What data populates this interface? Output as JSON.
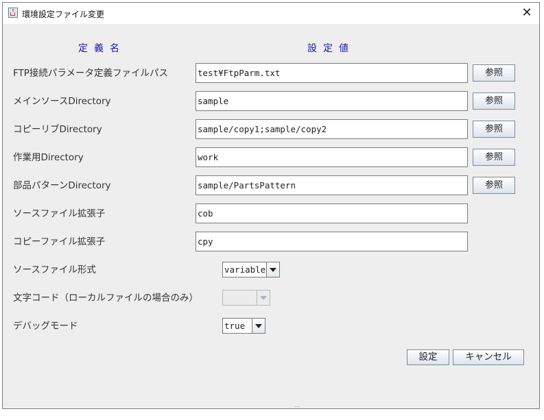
{
  "window": {
    "title": "環境設定ファイル変更",
    "close_glyph": "✕",
    "app_icon": "java-app-icon"
  },
  "headers": {
    "name_column": "定義名",
    "value_column": "設定値"
  },
  "fields": [
    {
      "label": "FTP接続パラメータ定義ファイルパス",
      "value": "test¥FtpParm.txt",
      "browse_label": "参照"
    },
    {
      "label": "メインソースDirectory",
      "value": "sample",
      "browse_label": "参照"
    },
    {
      "label": "コピーリブDirectory",
      "value": "sample/copy1;sample/copy2",
      "browse_label": "参照"
    },
    {
      "label": "作業用Directory",
      "value": "work",
      "browse_label": "参照"
    },
    {
      "label": "部品パターンDirectory",
      "value": "sample/PartsPattern",
      "browse_label": "参照"
    },
    {
      "label": "ソースファイル拡張子",
      "value": "cob"
    },
    {
      "label": "コピーファイル拡張子",
      "value": "cpy"
    }
  ],
  "combos": [
    {
      "label": "ソースファイル形式",
      "selected": "variable",
      "enabled": true
    },
    {
      "label": "文字コード（ローカルファイルの場合のみ）",
      "selected": "",
      "enabled": false
    },
    {
      "label": "デバッグモード",
      "selected": "true",
      "enabled": true
    }
  ],
  "buttons": {
    "ok_label": "設定",
    "cancel_label": "キャンセル"
  },
  "colors": {
    "header_text": "#1a1aa6",
    "background": "#eeeeee"
  }
}
